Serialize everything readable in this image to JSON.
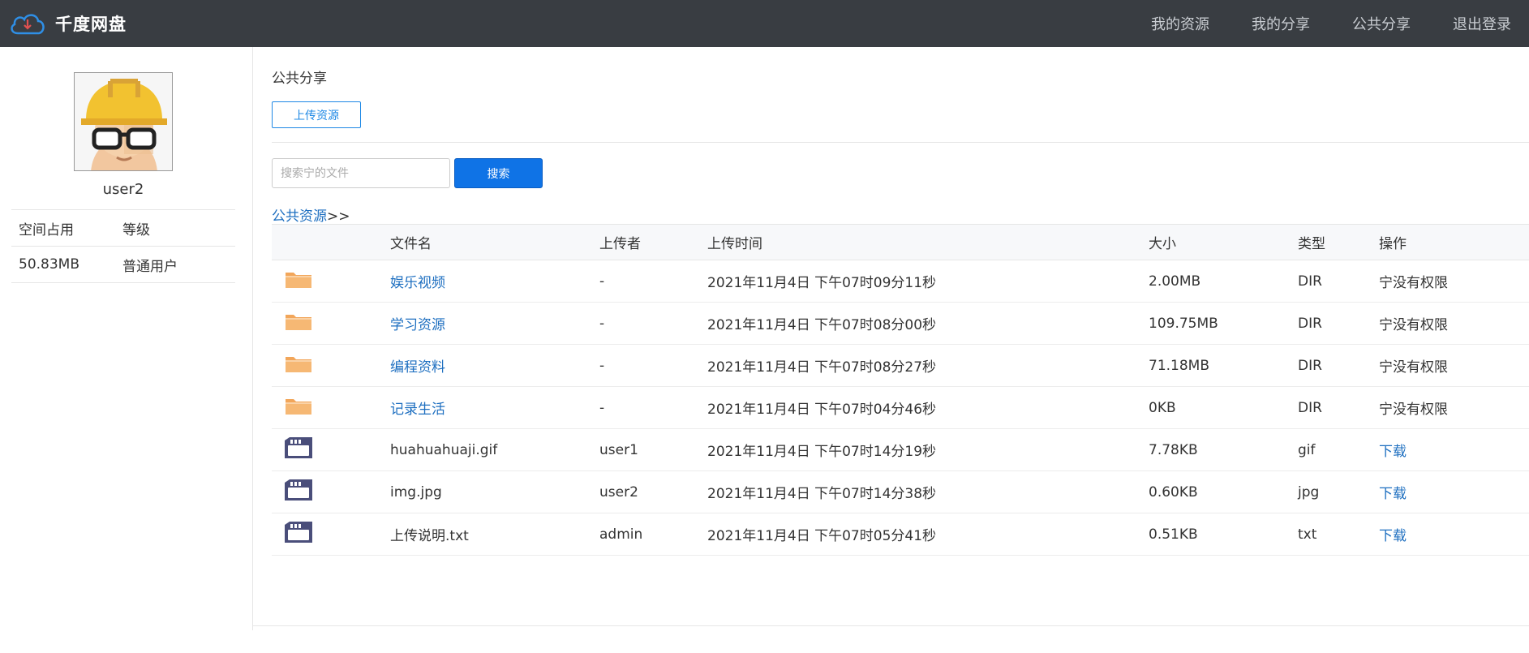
{
  "app": {
    "brand": "千度网盘",
    "nav": [
      "我的资源",
      "我的分享",
      "公共分享",
      "退出登录"
    ]
  },
  "colors": {
    "topbar": "#393d42",
    "accent": "#1e6fc0",
    "primary_button": "#0f73e6",
    "folder": "#f2a65a",
    "file_icon": "#4a4e7a"
  },
  "sidebar": {
    "username": "user2",
    "stats_header": [
      "空间占用",
      "等级"
    ],
    "stats_values": [
      "50.83MB",
      "普通用户"
    ]
  },
  "main": {
    "title": "公共分享",
    "upload_label": "上传资源",
    "search_placeholder": "搜索宁的文件",
    "search_label": "搜索",
    "breadcrumb_link": "公共资源",
    "breadcrumb_suffix": ">>"
  },
  "table": {
    "headers": [
      "文件名",
      "上传者",
      "上传时间",
      "大小",
      "类型",
      "操作"
    ],
    "rows": [
      {
        "icon": "folder-icon",
        "name": "娱乐视频",
        "uploader": "-",
        "time": "2021年11月4日 下午07时09分11秒",
        "size": "2.00MB",
        "type": "DIR",
        "op": "宁没有权限"
      },
      {
        "icon": "folder-icon",
        "name": "学习资源",
        "uploader": "-",
        "time": "2021年11月4日 下午07时08分00秒",
        "size": "109.75MB",
        "type": "DIR",
        "op": "宁没有权限"
      },
      {
        "icon": "folder-icon",
        "name": "编程资料",
        "uploader": "-",
        "time": "2021年11月4日 下午07时08分27秒",
        "size": "71.18MB",
        "type": "DIR",
        "op": "宁没有权限"
      },
      {
        "icon": "folder-icon",
        "name": "记录生活",
        "uploader": "-",
        "time": "2021年11月4日 下午07时04分46秒",
        "size": "0KB",
        "type": "DIR",
        "op": "宁没有权限"
      },
      {
        "icon": "file-icon",
        "name": "huahuahuaji.gif",
        "uploader": "user1",
        "time": "2021年11月4日 下午07时14分19秒",
        "size": "7.78KB",
        "type": "gif",
        "op": "下载"
      },
      {
        "icon": "file-icon",
        "name": "img.jpg",
        "uploader": "user2",
        "time": "2021年11月4日 下午07时14分38秒",
        "size": "0.60KB",
        "type": "jpg",
        "op": "下载"
      },
      {
        "icon": "file-icon",
        "name": "上传说明.txt",
        "uploader": "admin",
        "time": "2021年11月4日 下午07时05分41秒",
        "size": "0.51KB",
        "type": "txt",
        "op": "下载"
      }
    ]
  }
}
